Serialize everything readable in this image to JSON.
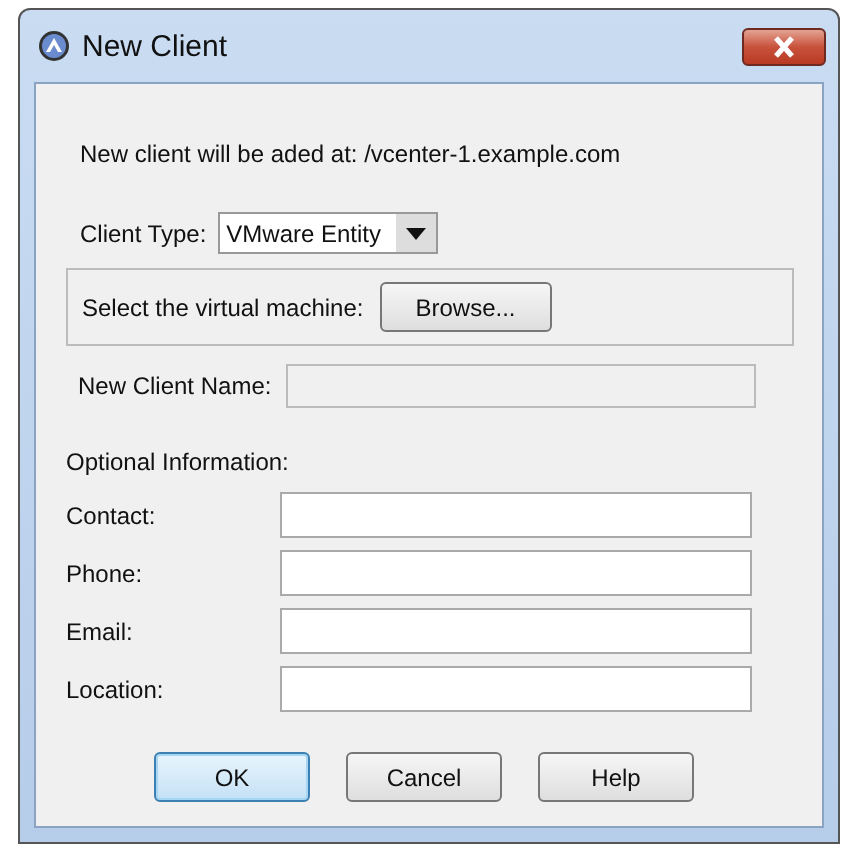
{
  "window": {
    "title": "New Client"
  },
  "message": "New client will be aded at: /vcenter-1.example.com",
  "client_type": {
    "label": "Client Type:",
    "value": "VMware Entity"
  },
  "vm_select": {
    "label": "Select the virtual machine:",
    "button": "Browse..."
  },
  "client_name": {
    "label": "New Client Name:",
    "disabled": true
  },
  "optional": {
    "heading": "Optional Information:",
    "fields": [
      {
        "label": "Contact:"
      },
      {
        "label": "Phone:"
      },
      {
        "label": "Email:"
      },
      {
        "label": "Location:"
      }
    ]
  },
  "buttons": [
    {
      "label": "OK",
      "default": true
    },
    {
      "label": "Cancel",
      "default": false
    },
    {
      "label": "Help",
      "default": false
    }
  ]
}
